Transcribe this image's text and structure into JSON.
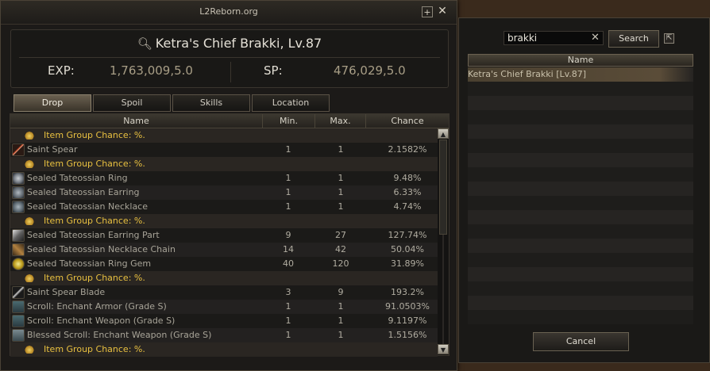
{
  "window": {
    "title": "L2Reborn.org"
  },
  "header": {
    "target": "Ketra's Chief Brakki, Lv.87",
    "exp_label": "EXP:",
    "exp_value": "1,763,009,5.0",
    "sp_label": "SP:",
    "sp_value": "476,029,5.0"
  },
  "tabs": [
    {
      "label": "Drop",
      "active": true
    },
    {
      "label": "Spoil"
    },
    {
      "label": "Skills"
    },
    {
      "label": "Location"
    }
  ],
  "table": {
    "columns": [
      "Name",
      "Min.",
      "Max.",
      "Chance"
    ],
    "rows": [
      {
        "type": "group",
        "name": "Item Group Chance: %."
      },
      {
        "type": "item",
        "icon": "spear-icon",
        "name": "Saint Spear",
        "min": "1",
        "max": "1",
        "chance": "2.1582%"
      },
      {
        "type": "group",
        "name": "Item Group Chance: %."
      },
      {
        "type": "item",
        "icon": "ring-icon",
        "name": "Sealed Tateossian Ring",
        "min": "1",
        "max": "1",
        "chance": "9.48%"
      },
      {
        "type": "item",
        "icon": "earring-icon",
        "name": "Sealed Tateossian Earring",
        "min": "1",
        "max": "1",
        "chance": "6.33%"
      },
      {
        "type": "item",
        "icon": "necklace-icon",
        "name": "Sealed Tateossian Necklace",
        "min": "1",
        "max": "1",
        "chance": "4.74%"
      },
      {
        "type": "group",
        "name": "Item Group Chance: %."
      },
      {
        "type": "item",
        "icon": "earring-part-icon",
        "name": "Sealed Tateossian Earring Part",
        "min": "9",
        "max": "27",
        "chance": "127.74%"
      },
      {
        "type": "item",
        "icon": "necklace-chain-icon",
        "name": "Sealed Tateossian Necklace Chain",
        "min": "14",
        "max": "42",
        "chance": "50.04%"
      },
      {
        "type": "item",
        "icon": "ring-gem-icon",
        "name": "Sealed Tateossian Ring Gem",
        "min": "40",
        "max": "120",
        "chance": "31.89%"
      },
      {
        "type": "group",
        "name": "Item Group Chance: %."
      },
      {
        "type": "item",
        "icon": "blade-icon",
        "name": "Saint Spear Blade",
        "min": "3",
        "max": "9",
        "chance": "193.2%"
      },
      {
        "type": "item",
        "icon": "scroll-icon",
        "name": "Scroll: Enchant Armor (Grade S)",
        "min": "1",
        "max": "1",
        "chance": "91.0503%"
      },
      {
        "type": "item",
        "icon": "scroll-icon",
        "name": "Scroll: Enchant Weapon (Grade S)",
        "min": "1",
        "max": "1",
        "chance": "9.1197%"
      },
      {
        "type": "item",
        "icon": "blessed-scroll-icon",
        "name": "Blessed Scroll: Enchant Weapon (Grade S)",
        "min": "1",
        "max": "1",
        "chance": "1.5156%"
      },
      {
        "type": "group",
        "name": "Item Group Chance: %."
      }
    ]
  },
  "search": {
    "query": "brakki",
    "button": "Search",
    "column": "Name",
    "results": [
      "Ketra's Chief Brakki [Lv.87]"
    ],
    "cancel": "Cancel"
  }
}
